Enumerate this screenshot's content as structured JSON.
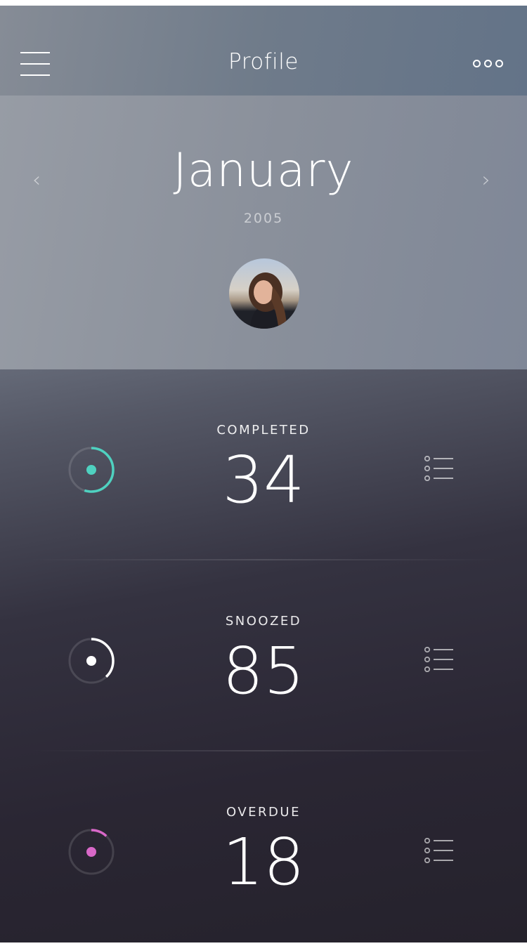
{
  "header": {
    "title": "Profile",
    "menu_icon": "hamburger-icon",
    "more_icon": "more-dots-icon"
  },
  "hero": {
    "month": "January",
    "year": "2005",
    "prev_icon": "chevron-left-icon",
    "next_icon": "chevron-right-icon",
    "prev_glyph": "‹",
    "next_glyph": "›"
  },
  "stats": [
    {
      "label": "COMPLETED",
      "value": "34",
      "progress": 0.55,
      "color": "#4fd1c0"
    },
    {
      "label": "SNOOZED",
      "value": "85",
      "progress": 0.38,
      "color": "#ffffff"
    },
    {
      "label": "OVERDUE",
      "value": "18",
      "progress": 0.12,
      "color": "#d868c8"
    }
  ]
}
